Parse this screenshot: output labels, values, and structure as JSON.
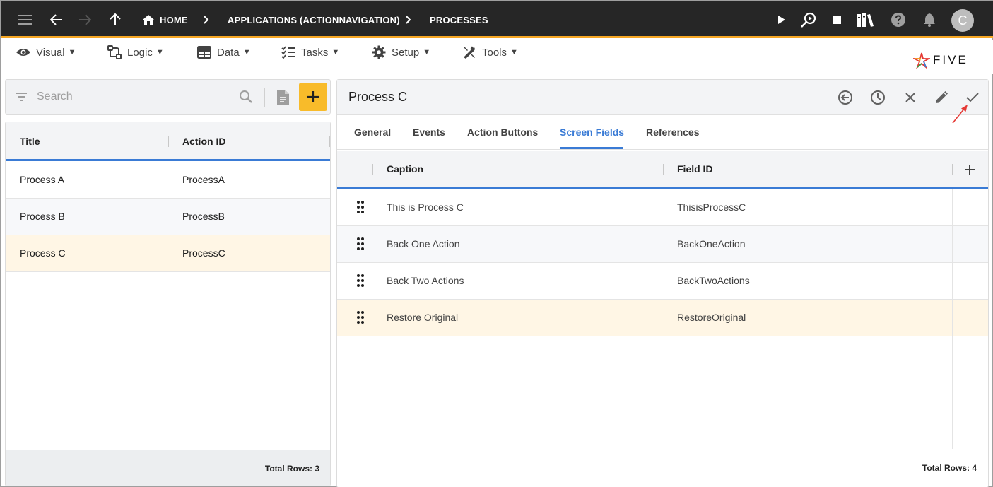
{
  "appbar": {
    "breadcrumbs": [
      "HOME",
      "APPLICATIONS (ACTIONNAVIGATION)",
      "PROCESSES"
    ],
    "avatar_letter": "C",
    "accent_color": "#f5a623"
  },
  "menu": {
    "items": [
      {
        "label": "Visual",
        "icon": "eye-icon"
      },
      {
        "label": "Logic",
        "icon": "logic-icon"
      },
      {
        "label": "Data",
        "icon": "table-icon"
      },
      {
        "label": "Tasks",
        "icon": "checklist-icon"
      },
      {
        "label": "Setup",
        "icon": "gear-icon"
      },
      {
        "label": "Tools",
        "icon": "tools-icon"
      }
    ],
    "logo_text": "FIVE"
  },
  "left": {
    "search_placeholder": "Search",
    "columns": [
      "Title",
      "Action ID"
    ],
    "rows": [
      {
        "title": "Process A",
        "action_id": "ProcessA"
      },
      {
        "title": "Process B",
        "action_id": "ProcessB"
      },
      {
        "title": "Process C",
        "action_id": "ProcessC"
      }
    ],
    "total_rows": "Total Rows: 3"
  },
  "right": {
    "title": "Process C",
    "tabs": [
      "General",
      "Events",
      "Action Buttons",
      "Screen Fields",
      "References"
    ],
    "active_tab": "Screen Fields",
    "columns": [
      "Caption",
      "Field ID"
    ],
    "rows": [
      {
        "caption": "This is Process C",
        "field_id": "ThisisProcessC"
      },
      {
        "caption": "Back One Action",
        "field_id": "BackOneAction"
      },
      {
        "caption": "Back Two Actions",
        "field_id": "BackTwoActions"
      },
      {
        "caption": "Restore Original",
        "field_id": "RestoreOriginal"
      }
    ],
    "total_rows": "Total Rows: 4"
  },
  "colors": {
    "primary_blue": "#3a7bd5",
    "add_button": "#f8bb2a",
    "selected_row": "#fff6e5",
    "alt_row": "#f7f8fa",
    "annotation_arrow": "#e53935"
  }
}
